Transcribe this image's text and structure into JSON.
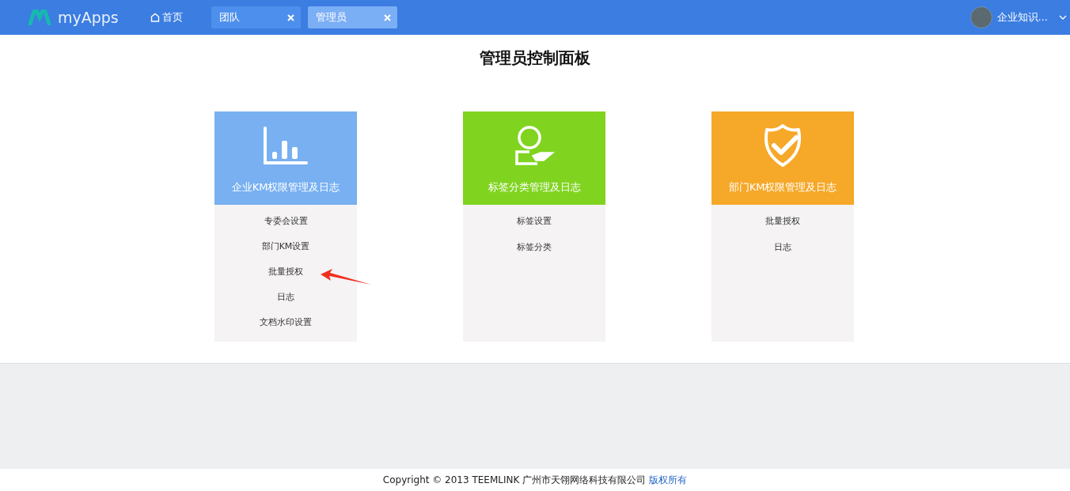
{
  "header": {
    "logo": "myApps",
    "home": "首页",
    "tabs": [
      {
        "label": "团队",
        "selected": false
      },
      {
        "label": "管理员",
        "selected": true
      }
    ],
    "user": {
      "name": "企业知识..."
    }
  },
  "title": "管理员控制面板",
  "cards": [
    {
      "kind": "chart",
      "title": "企业KM权限管理及日志",
      "color": "#78b0f1",
      "items": [
        "专委会设置",
        "部门KM设置",
        "批量授权",
        "日志",
        "文档水印设置"
      ]
    },
    {
      "kind": "person",
      "title": "标签分类管理及日志",
      "color": "#80d420",
      "items": [
        "标签设置",
        "标签分类"
      ]
    },
    {
      "kind": "shield",
      "title": "部门KM权限管理及日志",
      "color": "#f6a829",
      "items": [
        "批量授权",
        "日志"
      ]
    }
  ],
  "footer": {
    "text": "Copyright © 2013 TEEMLINK 广州市天翎网络科技有限公司",
    "link": "版权所有"
  }
}
